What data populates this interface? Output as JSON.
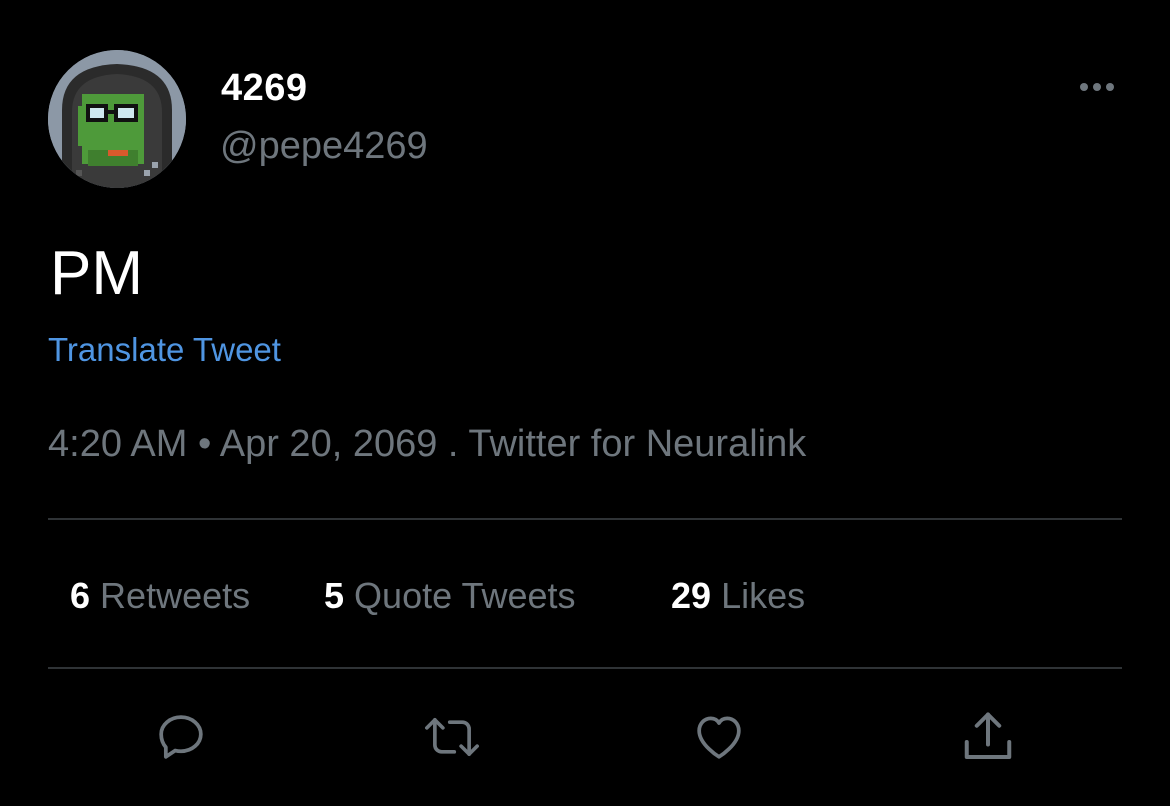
{
  "author": {
    "display_name": "4269",
    "handle": "@pepe4269",
    "avatar_icon": "pixel-pepe-hoodie-avatar"
  },
  "menu": {
    "more_icon": "more-horizontal-icon"
  },
  "tweet": {
    "text": "PM",
    "translate_label": "Translate Tweet",
    "meta": "4:20 AM • Apr 20, 2069 . Twitter for Neuralink"
  },
  "stats": {
    "retweets": {
      "count": "6",
      "label": "Retweets"
    },
    "quote_tweets": {
      "count": "5",
      "label": "Quote Tweets"
    },
    "likes": {
      "count": "29",
      "label": "Likes"
    }
  },
  "actions": [
    {
      "name": "reply",
      "icon": "reply-icon"
    },
    {
      "name": "retweet",
      "icon": "retweet-icon"
    },
    {
      "name": "like",
      "icon": "heart-icon"
    },
    {
      "name": "share",
      "icon": "share-icon"
    }
  ],
  "colors": {
    "background": "#000000",
    "text_primary": "#ffffff",
    "text_secondary": "#6e767d",
    "link": "#4f95e2",
    "divider": "#2f3336"
  }
}
